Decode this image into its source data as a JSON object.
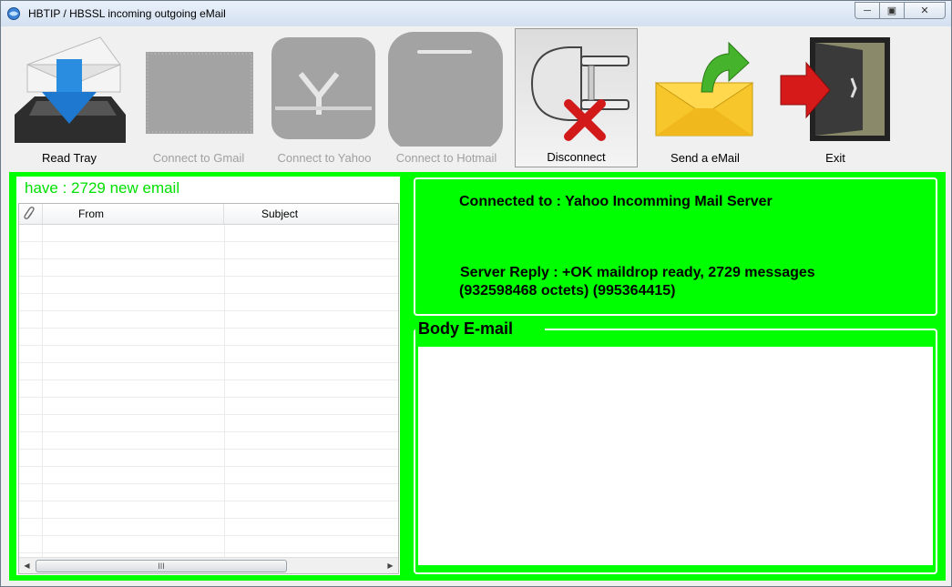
{
  "window": {
    "title": "HBTIP / HBSSL incoming outgoing eMail"
  },
  "toolbar": {
    "read_tray": "Read Tray",
    "connect_gmail": "Connect to Gmail",
    "connect_yahoo": "Connect to Yahoo",
    "connect_hotmail": "Connect to Hotmail",
    "disconnect": "Disconnect",
    "send_email": "Send a eMail",
    "exit": "Exit"
  },
  "inbox": {
    "new_mail_status": "have : 2729 new email",
    "columns": [
      "From",
      "Subject"
    ],
    "rows": [],
    "scroll_thumb": "III"
  },
  "server": {
    "connected_to": "Connected to : Yahoo   Incomming Mail Server",
    "reply_line1": "Server Reply : +OK maildrop ready, 2729 messages",
    "reply_line2": "(932598468 octets) (995364415)"
  },
  "body": {
    "legend": "Body E-mail",
    "content": ""
  },
  "colors": {
    "panel_bg": "#00ff00",
    "status_text": "#00e000"
  }
}
